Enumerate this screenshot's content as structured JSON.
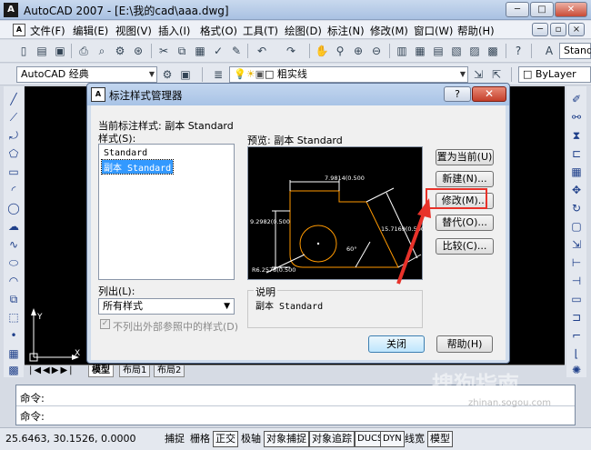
{
  "window": {
    "title": "AutoCAD 2007 - [E:\\我的cad\\aaa.dwg]",
    "app_icon": "A",
    "minimize": "─",
    "restore": "□",
    "close": "✕"
  },
  "doc_controls": {
    "minimize": "─",
    "restore": "▫",
    "close": "×"
  },
  "menubar": {
    "items": [
      "文件(F)",
      "编辑(E)",
      "视图(V)",
      "插入(I)",
      "格式(O)",
      "工具(T)",
      "绘图(D)",
      "标注(N)",
      "修改(M)",
      "窗口(W)",
      "帮助(H)"
    ]
  },
  "toolbar": {
    "workspace": "AutoCAD 经典",
    "linetype": "粗实线",
    "lineweight": "ByLayer",
    "textstyle": "Stand"
  },
  "tabs": [
    "模型",
    "布局1",
    "布局2"
  ],
  "command": {
    "line1": "命令:",
    "line2": "命令:"
  },
  "status": {
    "coords": "25.6463, 30.1526, 0.0000",
    "buttons": [
      "捕捉",
      "栅格",
      "正交",
      "极轴",
      "对象捕捉",
      "对象追踪",
      "DUCS",
      "DYN",
      "线宽",
      "模型"
    ]
  },
  "dialog": {
    "title": "标注样式管理器",
    "icon": "A",
    "help_btn": "?",
    "close_btn": "✕",
    "current_style_label": "当前标注样式: 副本 Standard",
    "styles_label": "样式(S):",
    "styles": [
      "Standard",
      "副本 Standard"
    ],
    "selected_style": "副本 Standard",
    "preview_label": "预览: 副本 Standard",
    "list_label": "列出(L):",
    "list_value": "所有样式",
    "exclude_xref": "不列出外部参照中的样式(D)",
    "desc_label": "说明",
    "desc_value": "副本 Standard",
    "buttons": {
      "set_current": "置为当前(U)",
      "new": "新建(N)...",
      "modify": "修改(M)...",
      "override": "替代(O)...",
      "compare": "比较(C)...",
      "close": "关闭",
      "help": "帮助(H)"
    },
    "preview_dims": {
      "top": "7.9814(0.500",
      "left": "9.2982(0.500",
      "right": "15.7169(0.500",
      "angle": "60°",
      "radius": "R6.2578(0.500"
    }
  },
  "watermark": {
    "text": "搜狗指南",
    "url": "zhinan.sogou.com"
  },
  "colors": {
    "highlight_red": "#e8322a",
    "selection_blue": "#3399ff",
    "preview_geometry": "#ff9900"
  }
}
